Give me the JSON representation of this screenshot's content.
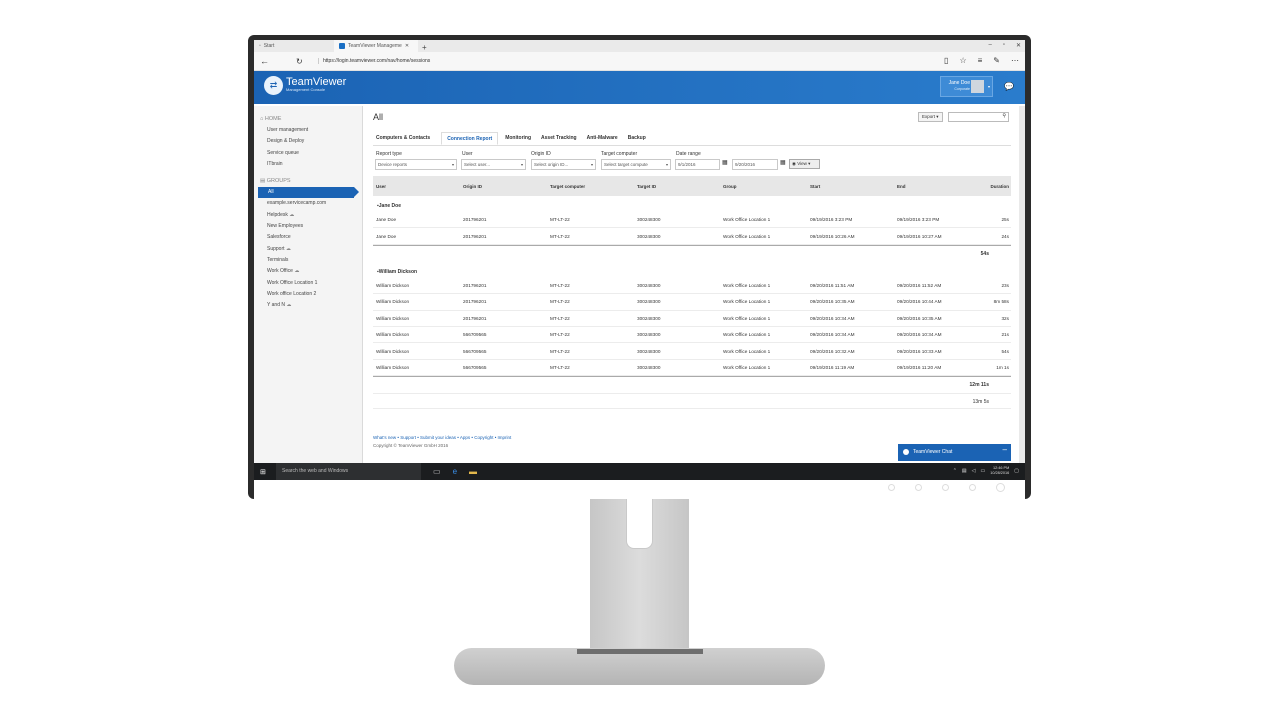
{
  "browser": {
    "tabs": [
      {
        "label": "Start"
      },
      {
        "label": "TeamViewer Manageme"
      }
    ],
    "new_tab": "+",
    "window_controls": [
      "–",
      "▫",
      "✕"
    ],
    "url": "https://login.teamviewer.com/nav/home/sessions"
  },
  "app": {
    "brand": "TeamViewer",
    "brand_sub": "Management Console",
    "user_name": "Jane Doe",
    "user_company": "Corporate"
  },
  "sidebar": {
    "home_header": "HOME",
    "home_items": [
      "User management",
      "Design & Deploy",
      "Service queue",
      "ITbrain"
    ],
    "groups_header": "GROUPS",
    "group_items": [
      {
        "label": "All",
        "cloud": ""
      },
      {
        "label": "example.servicecamp.com",
        "cloud": ""
      },
      {
        "label": "Helpdesk",
        "cloud": "☁"
      },
      {
        "label": "New Employees",
        "cloud": ""
      },
      {
        "label": "Salesforce",
        "cloud": ""
      },
      {
        "label": "Support",
        "cloud": "☁"
      },
      {
        "label": "Terminals",
        "cloud": ""
      },
      {
        "label": "Work Office",
        "cloud": "☁"
      },
      {
        "label": "Work Office Location 1",
        "cloud": ""
      },
      {
        "label": "Work office Location 2",
        "cloud": ""
      },
      {
        "label": "Y and N",
        "cloud": "☁"
      }
    ]
  },
  "main": {
    "title": "All",
    "export_label": "Export ▾",
    "search_icon": "⚲",
    "tabs": [
      "Computers & Contacts",
      "Connection Report",
      "Monitoring",
      "Asset Tracking",
      "Anti-Malware",
      "Backup"
    ],
    "filters": {
      "report_type_label": "Report type",
      "report_type_value": "Device reports",
      "user_label": "User",
      "user_placeholder": "Select user...",
      "origin_label": "Origin ID",
      "origin_placeholder": "Select origin ID...",
      "target_label": "Target computer",
      "target_placeholder": "Select target compute",
      "date_label": "Date range",
      "date_from": "9/1/2016",
      "date_to": "9/20/2016",
      "view_label": "View ▾"
    },
    "columns": [
      "User",
      "Origin ID",
      "Target computer",
      "Target ID",
      "Group",
      "Start",
      "End",
      "Duration"
    ],
    "groups": [
      {
        "name": "▪Jane Doe",
        "rows": [
          [
            "Jane Doe",
            "201796201",
            "MT-LT-22",
            "300248300",
            "Work Office Location 1",
            "09/19/2016 3:23 PM",
            "09/19/2016 3:23 PM",
            "25s"
          ],
          [
            "Jane Doe",
            "201796201",
            "MT-LT-22",
            "300248300",
            "Work Office Location 1",
            "09/19/2016 10:26 AM",
            "09/19/2016 10:27 AM",
            "24s"
          ]
        ],
        "subtotal": "54s"
      },
      {
        "name": "▪William Dickson",
        "rows": [
          [
            "William Dickson",
            "201796201",
            "MT-LT-22",
            "300248300",
            "Work Office Location 1",
            "09/20/2016 11:51 AM",
            "09/20/2016 11:52 AM",
            "23s"
          ],
          [
            "William Dickson",
            "201796201",
            "MT-LT-22",
            "300248300",
            "Work Office Location 1",
            "09/20/2016 10:35 AM",
            "09/20/2016 10:44 AM",
            "8m 58s"
          ],
          [
            "William Dickson",
            "201796201",
            "MT-LT-22",
            "300248300",
            "Work Office Location 1",
            "09/20/2016 10:34 AM",
            "09/20/2016 10:35 AM",
            "32s"
          ],
          [
            "William Dickson",
            "566709565",
            "MT-LT-22",
            "300248300",
            "Work Office Location 1",
            "09/20/2016 10:34 AM",
            "09/20/2016 10:34 AM",
            "21s"
          ],
          [
            "William Dickson",
            "566709565",
            "MT-LT-22",
            "300248300",
            "Work Office Location 1",
            "09/20/2016 10:32 AM",
            "09/20/2016 10:33 AM",
            "54s"
          ],
          [
            "William Dickson",
            "566709565",
            "MT-LT-22",
            "300248300",
            "Work Office Location 1",
            "09/19/2016 11:19 AM",
            "09/19/2016 11:20 AM",
            "1m 1s"
          ]
        ],
        "subtotal": "12m 11s"
      }
    ],
    "grand_total": "13m 5s",
    "footer_links": "What's new • Support • Submit your ideas • Apps • Copyright • Imprint",
    "copyright": "Copyright © TeamViewer GmbH 2016"
  },
  "chat": {
    "label": "TeamViewer Chat",
    "minimize": "–"
  },
  "taskbar": {
    "search_placeholder": "Search the web and Windows",
    "time": "12:46 PM",
    "date": "10/28/2016"
  }
}
